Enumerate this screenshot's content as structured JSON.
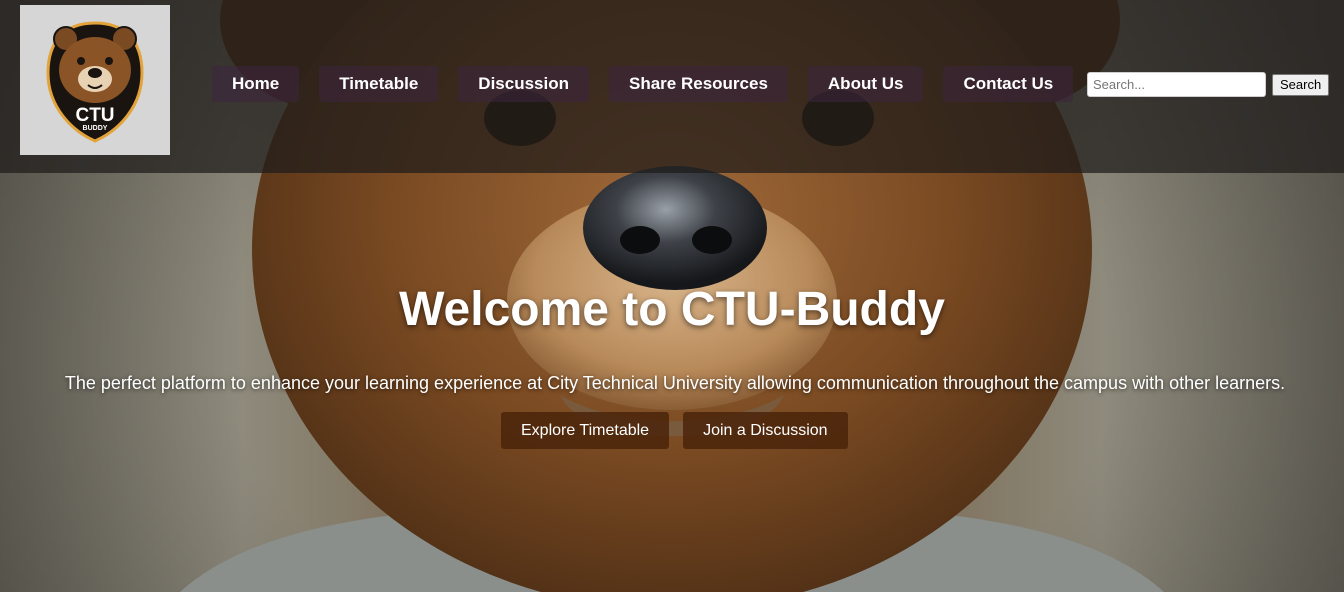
{
  "brand": {
    "logo_text": "CTU",
    "logo_subtext": "BUDDY"
  },
  "nav": {
    "items": [
      {
        "label": "Home"
      },
      {
        "label": "Timetable"
      },
      {
        "label": "Discussion"
      },
      {
        "label": "Share Resources"
      },
      {
        "label": "About Us"
      },
      {
        "label": "Contact Us"
      }
    ]
  },
  "search": {
    "placeholder": "Search...",
    "value": "",
    "button_label": "Search"
  },
  "hero": {
    "title": "Welcome to CTU-Buddy",
    "subtitle": "The perfect platform to enhance your learning experience at City Technical University allowing communication throughout the campus with other learners.",
    "buttons": [
      {
        "label": "Explore Timetable"
      },
      {
        "label": "Join a Discussion"
      }
    ]
  },
  "colors": {
    "header_overlay": "#1e1c1a",
    "nav_button": "#3c243e",
    "cta_button": "#4a240a",
    "logo_bg": "#d6d6d6",
    "bear_fur": "#7a4a22",
    "text": "#ffffff"
  },
  "icons": {
    "logo": "bear-mascot-icon",
    "background": "bear-photo"
  }
}
